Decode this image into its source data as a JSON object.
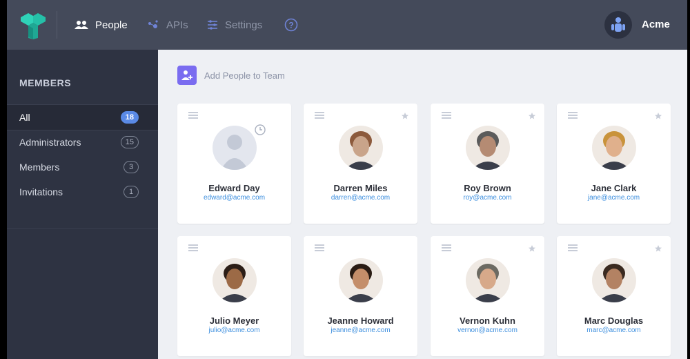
{
  "nav": {
    "people": "People",
    "apis": "APIs",
    "settings": "Settings"
  },
  "account": {
    "name": "Acme"
  },
  "sidebar": {
    "title": "MEMBERS",
    "items": [
      {
        "label": "All",
        "count": "18"
      },
      {
        "label": "Administrators",
        "count": "15"
      },
      {
        "label": "Members",
        "count": "3"
      },
      {
        "label": "Invitations",
        "count": "1"
      }
    ]
  },
  "main": {
    "add_label": "Add People to Team"
  },
  "people": [
    {
      "name": "Edward Day",
      "email": "edward@acme.com",
      "pending": true,
      "starred": false
    },
    {
      "name": "Darren Miles",
      "email": "darren@acme.com",
      "pending": false,
      "starred": true
    },
    {
      "name": "Roy Brown",
      "email": "roy@acme.com",
      "pending": false,
      "starred": true
    },
    {
      "name": "Jane Clark",
      "email": "jane@acme.com",
      "pending": false,
      "starred": true
    },
    {
      "name": "Julio Meyer",
      "email": "julio@acme.com",
      "pending": false,
      "starred": false
    },
    {
      "name": "Jeanne Howard",
      "email": "jeanne@acme.com",
      "pending": false,
      "starred": false
    },
    {
      "name": "Vernon Kuhn",
      "email": "vernon@acme.com",
      "pending": false,
      "starred": true
    },
    {
      "name": "Marc Douglas",
      "email": "marc@acme.com",
      "pending": false,
      "starred": true
    }
  ],
  "colors": {
    "topbar": "#444a5a",
    "sidebar": "#2e3342",
    "accent": "#5a8ae6",
    "add_button": "#7a6cf0",
    "link": "#3c8ede"
  }
}
